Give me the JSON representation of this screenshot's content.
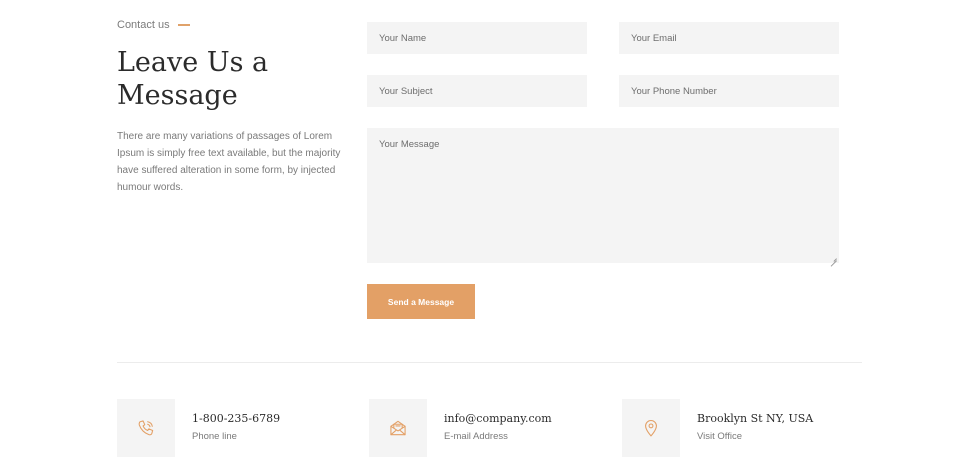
{
  "intro": {
    "tagline": "Contact us",
    "title": "Leave Us a Message",
    "description": "There are many variations of passages of Lorem Ipsum is simply free text available, but the majority have suffered alteration in some form, by injected humour words."
  },
  "form": {
    "name_placeholder": "Your Name",
    "email_placeholder": "Your Email",
    "subject_placeholder": "Your Subject",
    "phone_placeholder": "Your Phone Number",
    "message_placeholder": "Your Message",
    "submit_label": "Send a Message"
  },
  "contacts": [
    {
      "icon": "phone-icon",
      "value": "1-800-235-6789",
      "label": "Phone line"
    },
    {
      "icon": "envelope-icon",
      "value": "info@company.com",
      "label": "E-mail Address"
    },
    {
      "icon": "map-pin-icon",
      "value": "Brooklyn St NY, USA",
      "label": "Visit Office"
    }
  ],
  "colors": {
    "accent": "#e3a066",
    "field_bg": "#f4f4f4",
    "heading": "#2b2b2b",
    "body_text": "#7a7a7a"
  }
}
